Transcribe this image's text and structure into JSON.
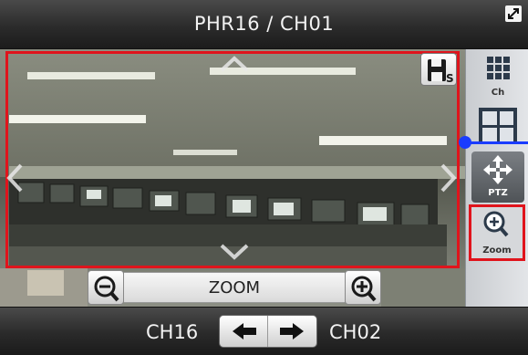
{
  "header": {
    "title": "PHR16 / CH01"
  },
  "viewer": {
    "zoom_label": "ZOOM"
  },
  "sidebar": {
    "ch_label": "Ch",
    "ptz_label": "PTZ",
    "zoom_label": "Zoom"
  },
  "footer": {
    "prev_channel": "CH16",
    "next_channel": "CH02"
  },
  "icons": {
    "fullscreen": "expand-icon",
    "save": "save-snapshot-icon",
    "ch": "grid-icon",
    "layout": "quad-layout-icon",
    "ptz": "move-icon",
    "zoom": "magnifier-icon"
  },
  "colors": {
    "highlight": "#e0141c",
    "splitter": "#1a3cff"
  }
}
